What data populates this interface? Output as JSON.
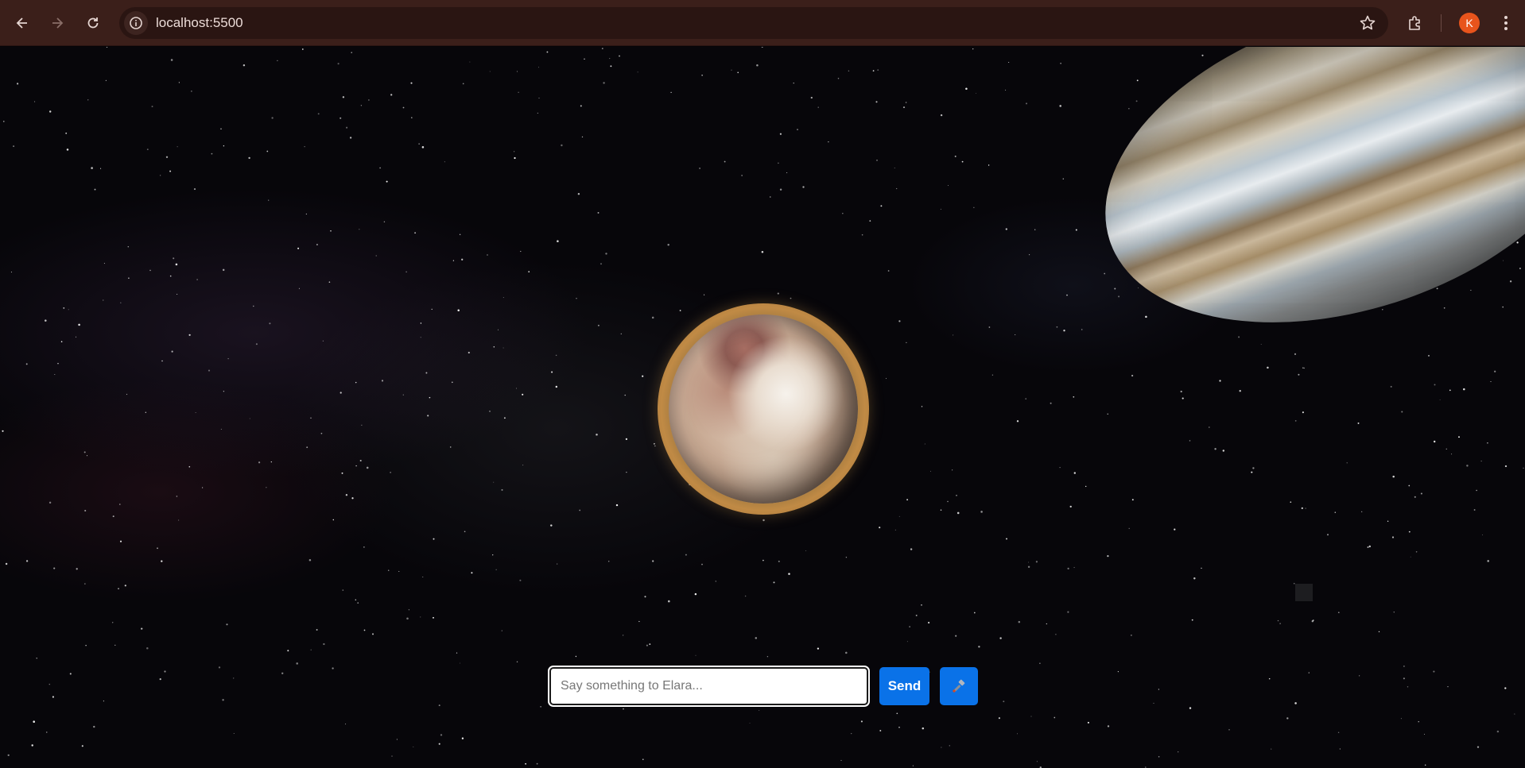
{
  "browser": {
    "url": "localhost:5500",
    "profile_initial": "K",
    "icons": {
      "back": "arrow-left-icon",
      "forward": "arrow-right-icon",
      "reload": "reload-icon",
      "site_info": "info-icon",
      "bookmark": "star-icon",
      "extensions": "puzzle-icon",
      "menu": "kebab-menu-icon"
    },
    "colors": {
      "toolbar": "#3b1f1a",
      "avatar": "#e8541c"
    }
  },
  "scene": {
    "background": "starfield",
    "objects": [
      "gas-giant-planet",
      "central-planet-with-ring",
      "small-square-marker"
    ]
  },
  "chat": {
    "input_value": "",
    "input_placeholder": "Say something to Elara...",
    "send_label": "Send",
    "tool_icon": "hammer-icon",
    "accent": "#0a72e8"
  }
}
